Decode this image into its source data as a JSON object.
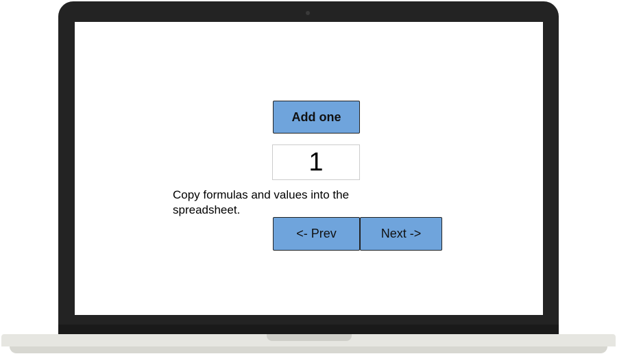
{
  "app": {
    "add_button_label": "Add one",
    "counter_value": "1",
    "instructions": "Copy formulas and values into the spreadsheet.",
    "prev_label": "<- Prev",
    "next_label": "Next ->"
  },
  "colors": {
    "button_fill": "#6fa4dc",
    "bezel": "#232323",
    "base": "#e6e6e1"
  }
}
